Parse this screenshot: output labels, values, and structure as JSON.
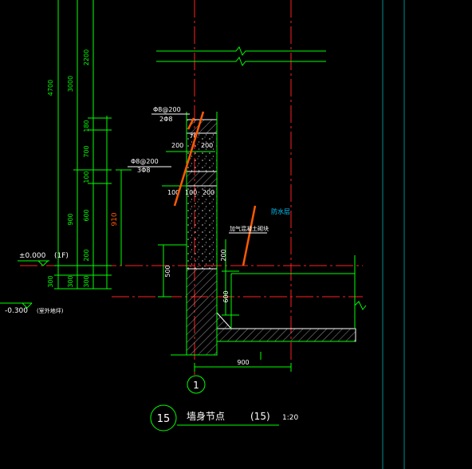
{
  "colors": {
    "background": "#000000",
    "dim_green": "#00ff00",
    "axis_red": "#ff2020",
    "structure_white": "#ffffff",
    "rebar_orange": "#ff5a00",
    "annotation_cyan": "#00c8ff",
    "grid_teal": "#008b8b",
    "hatch_gray": "#bdbdbd"
  },
  "vertical_dims": {
    "total": "4700",
    "upper": "3000",
    "top": "2200",
    "d180": "180",
    "d700": "700",
    "d100": "100",
    "d600": "600",
    "d900": "900",
    "d200": "200",
    "d300a": "300",
    "d300b": "300",
    "d300c": "300"
  },
  "horizontal_dims": {
    "w200a": "200",
    "w200b": "200",
    "w100a": "100",
    "w100b": "100",
    "w200c": "200",
    "w70": "70",
    "base": "900"
  },
  "wall_dims": {
    "h910": "910",
    "h200": "200",
    "h600": "600",
    "h500": "500"
  },
  "rebar_labels": {
    "top_spec": "Φ8@200",
    "top_bars": "2Φ8",
    "mid_spec": "Φ8@200",
    "mid_bars": "3Φ8"
  },
  "level_labels": {
    "zero": "±0.000",
    "floor": "(1F)",
    "ground": "-0.300",
    "ground_note": "(室外地坪)"
  },
  "annotations": {
    "infill": "加气混凝土砌块",
    "cyan_note": "防水层"
  },
  "axis_bubble": "1",
  "title_block": {
    "number": "15",
    "title": "墙身节点",
    "ref": "(15)",
    "scale": "1:20"
  }
}
